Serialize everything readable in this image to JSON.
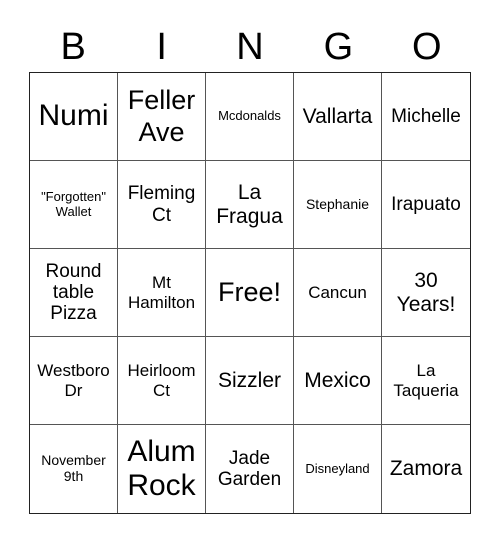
{
  "header": {
    "letters": [
      "B",
      "I",
      "N",
      "G",
      "O"
    ]
  },
  "board": {
    "rows": [
      [
        "Numi",
        "Feller Ave",
        "Mcdonalds",
        "Vallarta",
        "Michelle"
      ],
      [
        "\"Forgotten\" Wallet",
        "Fleming Ct",
        "La Fragua",
        "Stephanie",
        "Irapuato"
      ],
      [
        "Round table Pizza",
        "Mt Hamilton",
        "Free!",
        "Cancun",
        "30 Years!"
      ],
      [
        "Westboro Dr",
        "Heirloom Ct",
        "Sizzler",
        "Mexico",
        "La Taqueria"
      ],
      [
        "November 9th",
        "Alum Rock",
        "Jade Garden",
        "Disneyland",
        "Zamora"
      ]
    ],
    "free_space": "Free!"
  }
}
